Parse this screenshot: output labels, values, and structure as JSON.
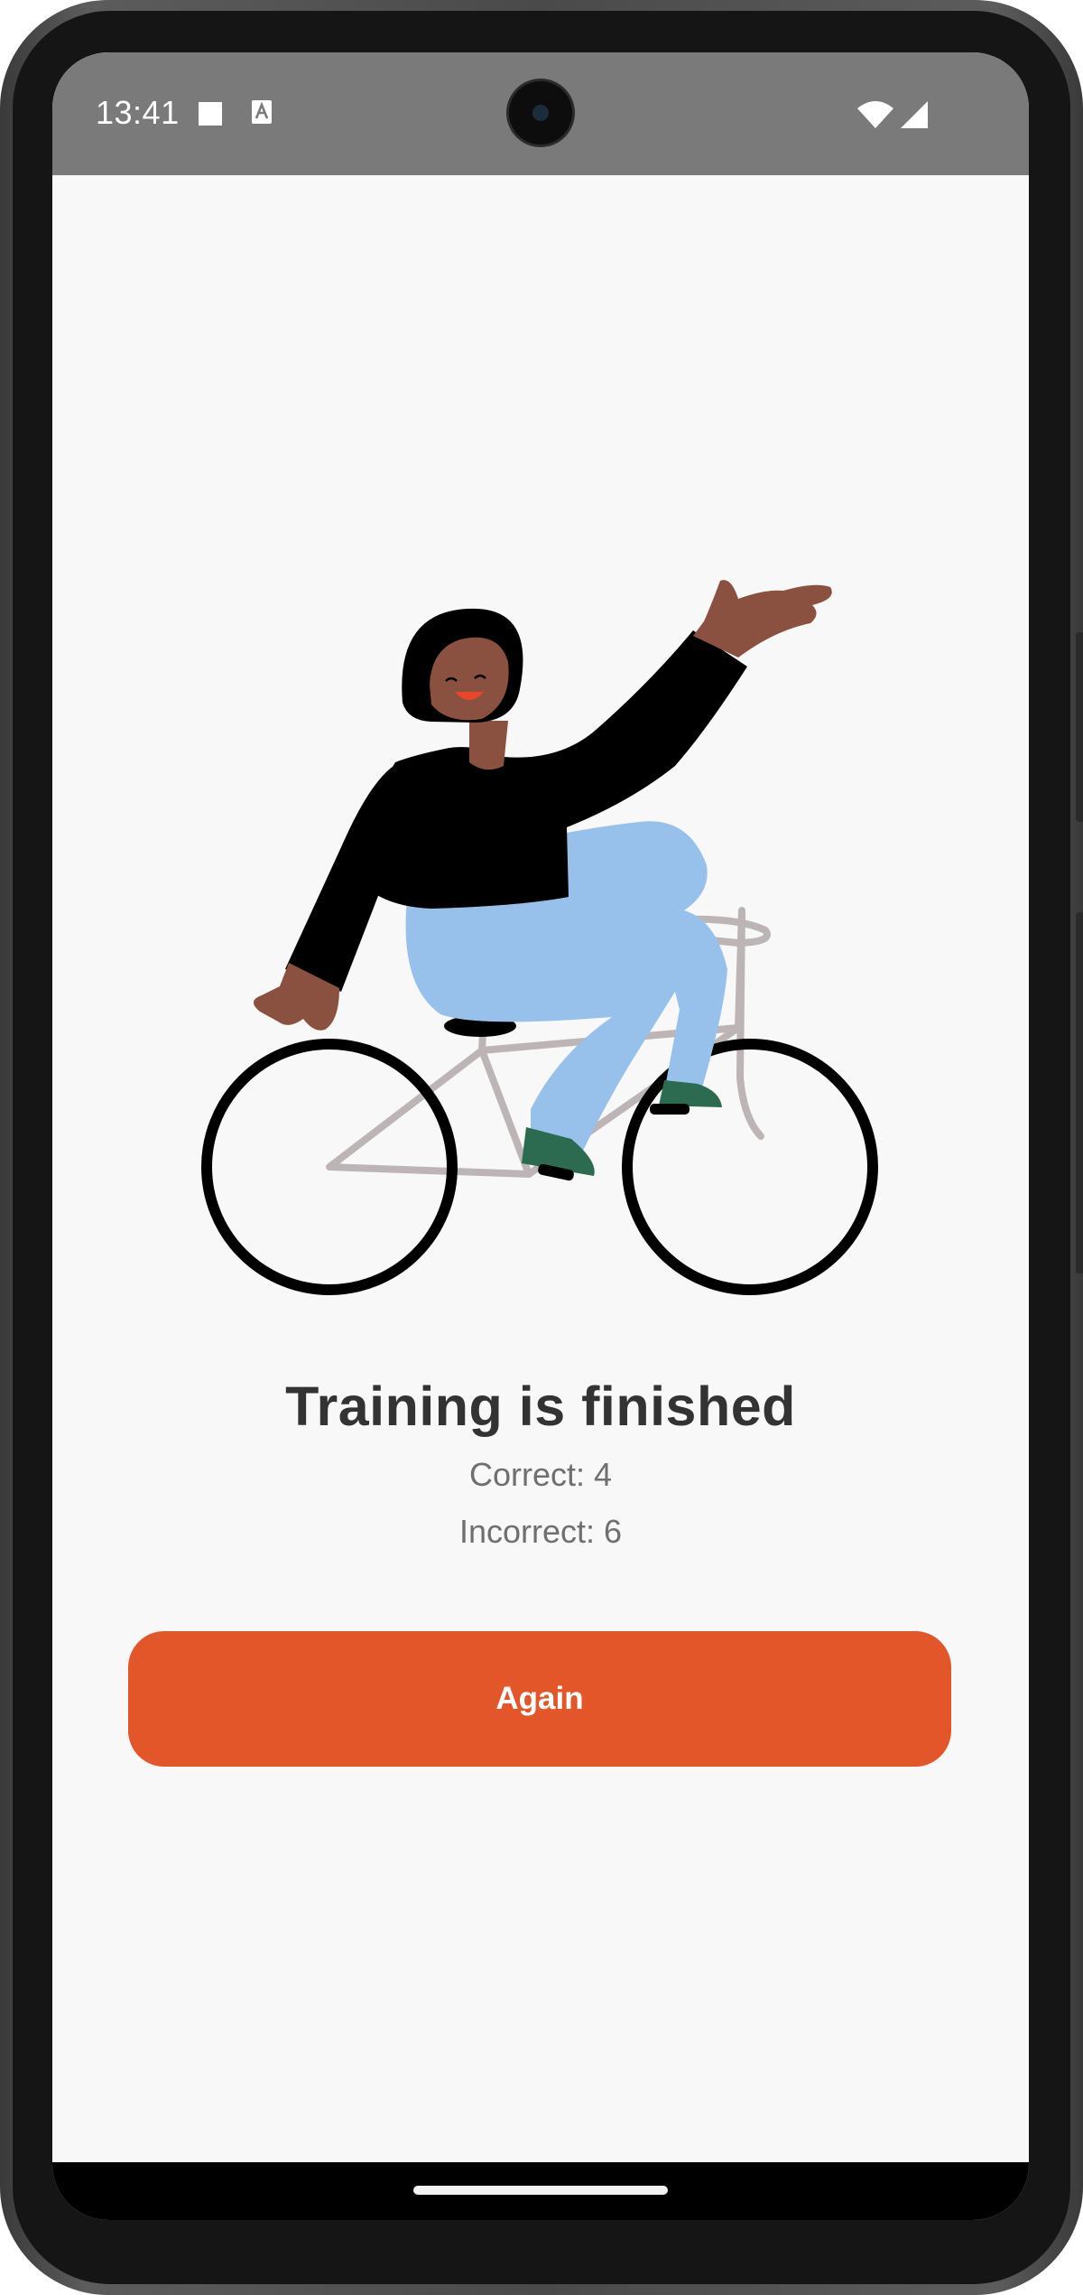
{
  "status_bar": {
    "time": "13:41",
    "icons": [
      "stop-square-icon",
      "font-a-icon",
      "wifi-icon",
      "cell-signal-icon"
    ]
  },
  "illustration": {
    "subject": "person-waving-on-bicycle-illustration"
  },
  "result": {
    "title": "Training is finished",
    "correct_text": "Correct: 4",
    "incorrect_text": "Incorrect: 6",
    "correct": 4,
    "incorrect": 6
  },
  "actions": {
    "again_label": "Again"
  },
  "colors": {
    "accent": "#e25629",
    "status_bar": "#7a7a7a",
    "background": "#f8f8f8",
    "title": "#333333",
    "stat_text": "#6f6f6f",
    "shirt": "#000000",
    "pants": "#97c0ea",
    "skin": "#8a5140",
    "bike_frame": "#bdb5b5",
    "shoes": "#2c6b50"
  }
}
